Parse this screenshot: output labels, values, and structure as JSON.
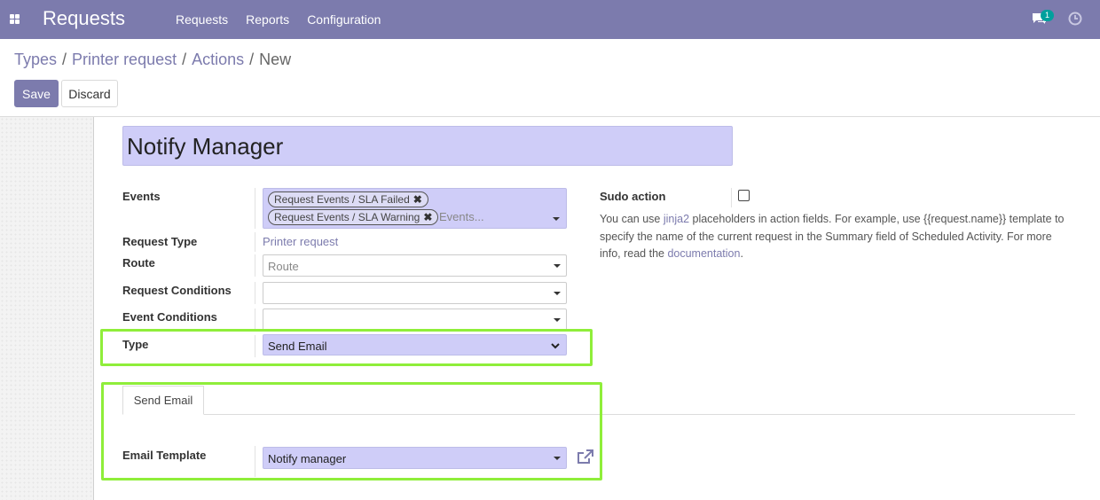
{
  "navbar": {
    "brand": "Requests",
    "menu": [
      "Requests",
      "Reports",
      "Configuration"
    ],
    "chat_badge": "1",
    "color": "#7c7bad"
  },
  "breadcrumb": {
    "items": [
      "Types",
      "Printer request",
      "Actions"
    ],
    "current": "New",
    "separator": "/"
  },
  "buttons": {
    "save": "Save",
    "discard": "Discard"
  },
  "form": {
    "name": "Notify Manager",
    "events": {
      "label": "Events",
      "tags": [
        "Request Events / SLA Failed",
        "Request Events / SLA Warning"
      ],
      "placeholder": "Events..."
    },
    "request_type": {
      "label": "Request Type",
      "value": "Printer request"
    },
    "route": {
      "label": "Route",
      "placeholder": "Route"
    },
    "request_conditions": {
      "label": "Request Conditions",
      "value": ""
    },
    "event_conditions": {
      "label": "Event Conditions",
      "value": ""
    },
    "type": {
      "label": "Type",
      "value": "Send Email"
    },
    "sudo": {
      "label": "Sudo action",
      "checked": false
    },
    "help": {
      "p1": "You can use ",
      "link1": "jinja2",
      "p2": " placeholders in action fields. For example, use {{request.name}} template to specify the name of the current request in the Summary field of Scheduled Activity. For more info, read the ",
      "link2": "documentation",
      "p3": "."
    },
    "tab": {
      "label": "Send Email"
    },
    "email_template": {
      "label": "Email Template",
      "value": "Notify manager"
    }
  },
  "highlight_color": "#8fee3a"
}
